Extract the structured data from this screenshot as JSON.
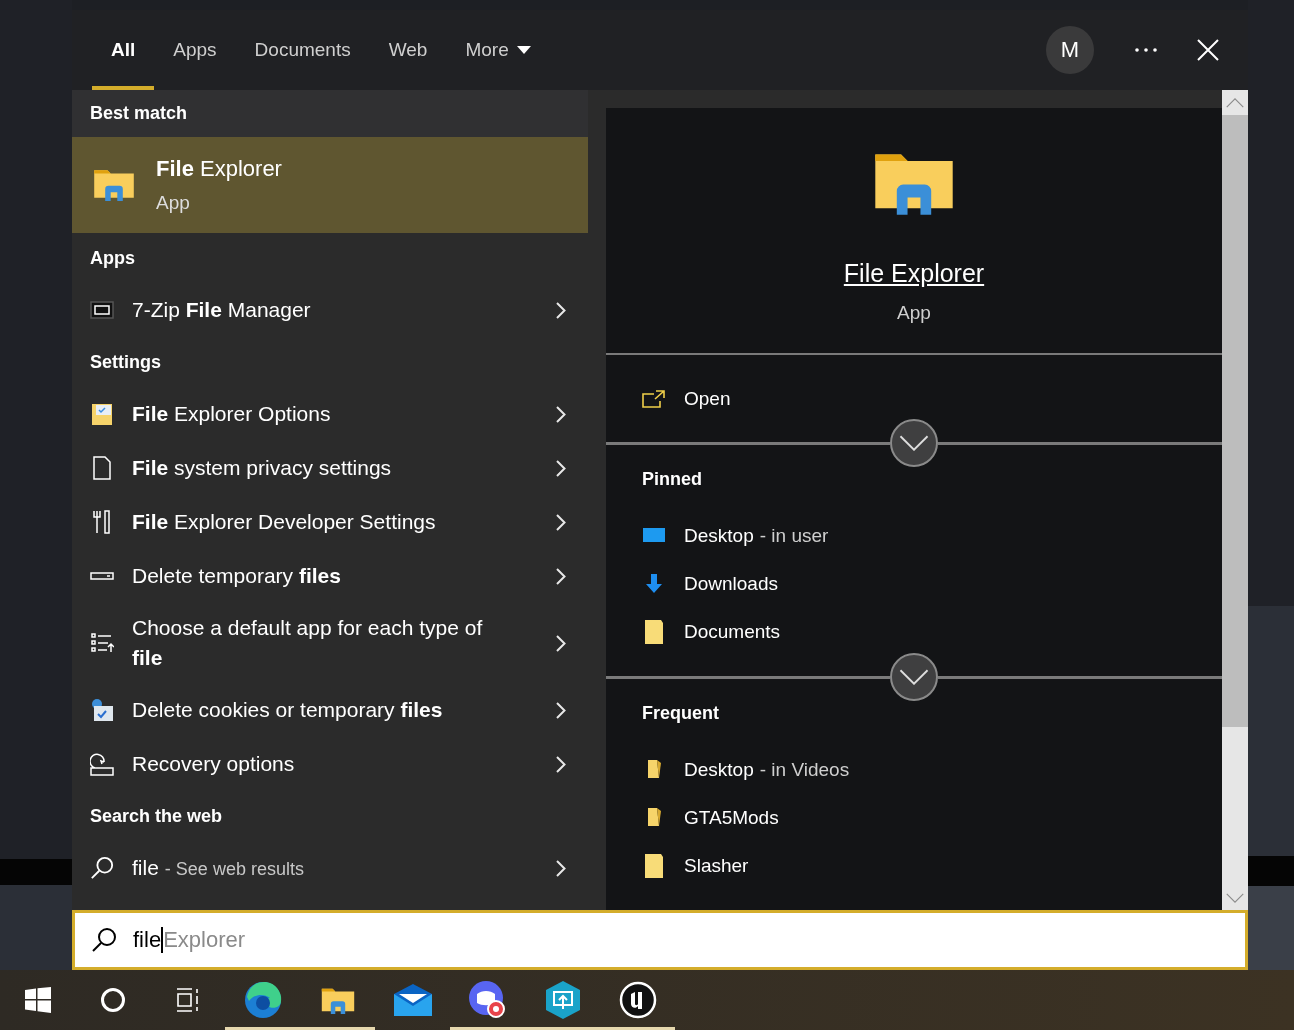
{
  "tabs": [
    {
      "label": "All",
      "selected": true,
      "dropdown": false
    },
    {
      "label": "Apps",
      "selected": false,
      "dropdown": false
    },
    {
      "label": "Documents",
      "selected": false,
      "dropdown": false
    },
    {
      "label": "Web",
      "selected": false,
      "dropdown": false
    },
    {
      "label": "More",
      "selected": false,
      "dropdown": true
    }
  ],
  "account": {
    "initial": "M"
  },
  "best_match": {
    "heading": "Best match",
    "title": "**File** Explorer",
    "subtitle": "App",
    "selected": true
  },
  "sections": [
    {
      "heading": "Apps",
      "items": [
        {
          "kind": "zip",
          "label": "7-Zip **File** Manager"
        }
      ]
    },
    {
      "heading": "Settings",
      "items": [
        {
          "kind": "options",
          "label": "**File** Explorer Options"
        },
        {
          "kind": "page",
          "label": "**File** system privacy settings"
        },
        {
          "kind": "tools",
          "label": "**File** Explorer Developer Settings"
        },
        {
          "kind": "drive",
          "label": "Delete temporary **files**"
        },
        {
          "kind": "list",
          "label": "Choose a default app for each type of **file**"
        },
        {
          "kind": "cookies",
          "label": "Delete cookies or temporary **files**"
        },
        {
          "kind": "recovery",
          "label": "Recovery options"
        }
      ]
    },
    {
      "heading": "Search the web",
      "items": [
        {
          "kind": "search",
          "label": "file",
          "detail": "- See web results"
        }
      ]
    }
  ],
  "preview": {
    "title": "File Explorer",
    "subtitle": "App",
    "actions": [
      {
        "label": "Open"
      }
    ],
    "groups": [
      {
        "heading": "Pinned",
        "items": [
          {
            "kind": "desktop",
            "name": "Desktop",
            "location": "- in user"
          },
          {
            "kind": "download",
            "name": "Downloads"
          },
          {
            "kind": "documents",
            "name": "Documents"
          }
        ]
      },
      {
        "heading": "Frequent",
        "items": [
          {
            "kind": "pinned",
            "name": "Desktop",
            "location": "- in Videos"
          },
          {
            "kind": "pinned",
            "name": "GTA5Mods"
          },
          {
            "kind": "documents",
            "name": "Slasher"
          }
        ]
      }
    ]
  },
  "search": {
    "value": "file",
    "suggestion": "Explorer"
  },
  "taskbar": [
    {
      "kind": "start",
      "running": false
    },
    {
      "kind": "cortana",
      "running": false
    },
    {
      "kind": "taskview",
      "running": false
    },
    {
      "kind": "edge",
      "running": true
    },
    {
      "kind": "explorer",
      "running": true
    },
    {
      "kind": "mail",
      "running": false
    },
    {
      "kind": "discord",
      "running": true
    },
    {
      "kind": "remote",
      "running": true
    },
    {
      "kind": "unreal",
      "running": true
    }
  ]
}
